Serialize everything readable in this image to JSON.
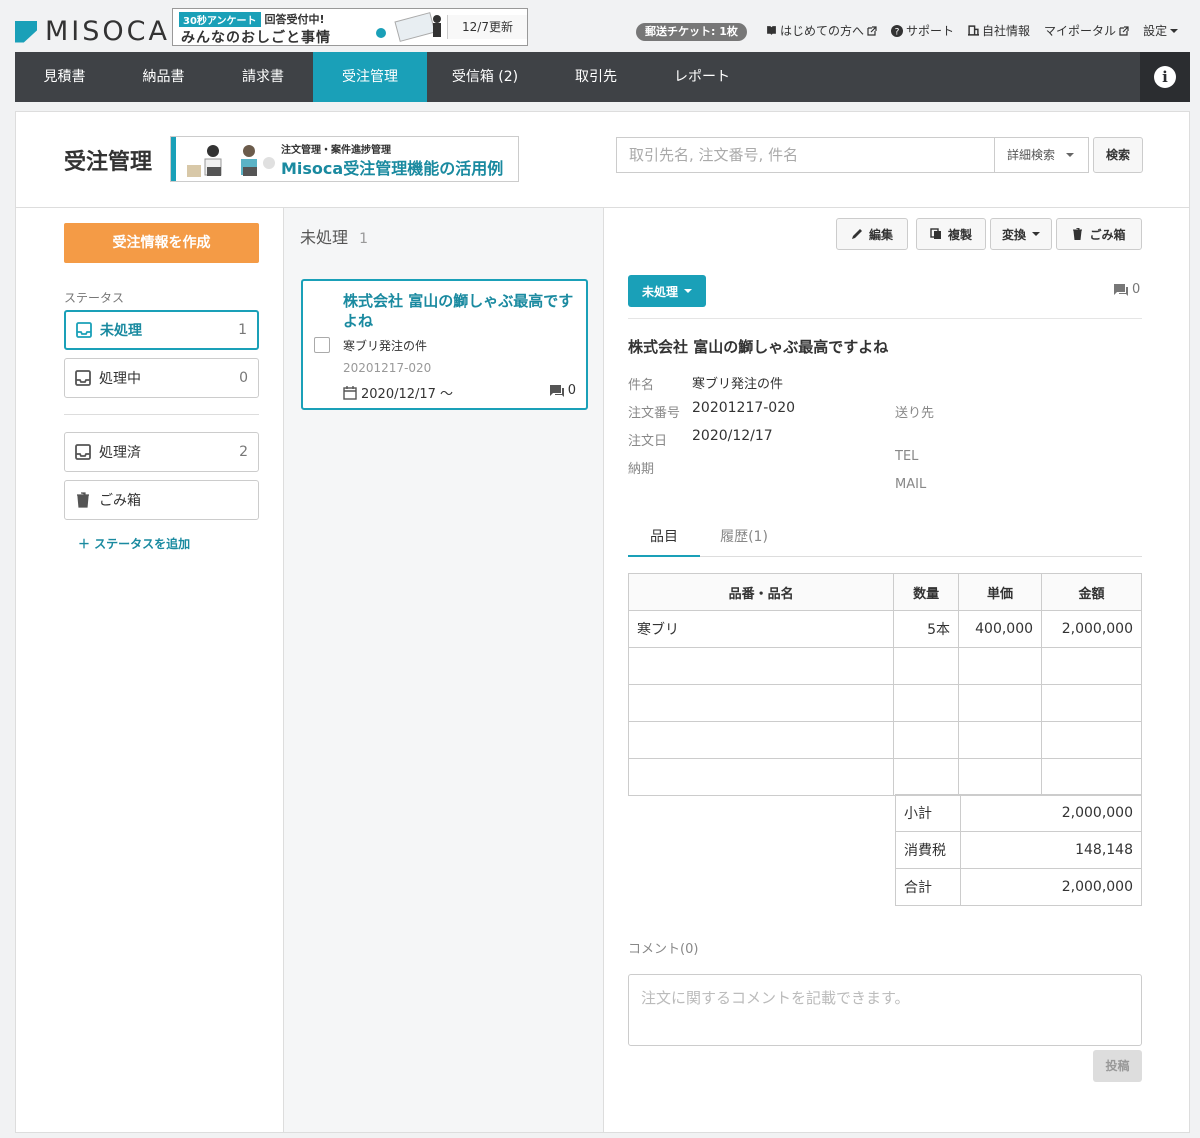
{
  "app": {
    "logo_text": "MISOCA"
  },
  "banner": {
    "tag": "30秒アンケート",
    "tagline": "回答受付中!",
    "main": "みんなのおしごと事情",
    "updated": "12/7更新"
  },
  "topbar": {
    "ticket": "郵送チケット: 1枚",
    "links": [
      {
        "label": "はじめての方へ"
      },
      {
        "label": "サポート"
      },
      {
        "label": "自社情報"
      },
      {
        "label": "マイポータル"
      },
      {
        "label": "設定"
      }
    ]
  },
  "nav": {
    "items": [
      {
        "label": "見積書"
      },
      {
        "label": "納品書"
      },
      {
        "label": "請求書"
      },
      {
        "label": "受注管理"
      },
      {
        "label": "受信箱 (2)"
      },
      {
        "label": "取引先"
      },
      {
        "label": "レポート"
      }
    ],
    "active_index": 3
  },
  "header": {
    "title": "受注管理",
    "hero_sub": "注文管理・案件進捗管理",
    "hero_main": "Misoca受注管理機能の活用例",
    "search_placeholder": "取引先名, 注文番号, 件名",
    "advanced": "詳細検索",
    "search_button": "検索"
  },
  "sidebar": {
    "create_button": "受注情報を作成",
    "status_label": "ステータス",
    "statuses": [
      {
        "label": "未処理",
        "count": "1"
      },
      {
        "label": "処理中",
        "count": "0"
      },
      {
        "label": "処理済",
        "count": "2"
      },
      {
        "label": "ごみ箱",
        "count": ""
      }
    ],
    "add_status": "＋ ステータスを追加"
  },
  "list": {
    "heading": "未処理",
    "count": "1",
    "card": {
      "company": "株式会社 富山の鰤しゃぶ最高ですよね",
      "subject": "寒ブリ発注の件",
      "order_no": "20201217-020",
      "date": "2020/12/17 〜",
      "comments": "0"
    }
  },
  "detail": {
    "toolbar": {
      "edit": "編集",
      "copy": "複製",
      "convert": "変換",
      "trash": "ごみ箱"
    },
    "status": "未処理",
    "comments": "0",
    "company": "株式会社 富山の鰤しゃぶ最高ですよね",
    "fields": {
      "subject_label": "件名",
      "subject": "寒ブリ発注の件",
      "order_no_label": "注文番号",
      "order_no": "20201217-020",
      "order_date_label": "注文日",
      "order_date": "2020/12/17",
      "due_label": "納期",
      "dest_label": "送り先",
      "tel_label": "TEL",
      "mail_label": "MAIL"
    },
    "tabs": [
      {
        "label": "品目"
      },
      {
        "label": "履歴(1)"
      }
    ],
    "table": {
      "headers": [
        "品番・品名",
        "数量",
        "単価",
        "金額"
      ],
      "rows": [
        [
          "寒ブリ",
          "5本",
          "400,000",
          "2,000,000"
        ]
      ]
    },
    "summary": [
      {
        "label": "小計",
        "value": "2,000,000"
      },
      {
        "label": "消費税",
        "value": "148,148"
      },
      {
        "label": "合計",
        "value": "2,000,000"
      }
    ],
    "comment_label": "コメント(0)",
    "comment_placeholder": "注文に関するコメントを記載できます。",
    "post_button": "投稿"
  }
}
